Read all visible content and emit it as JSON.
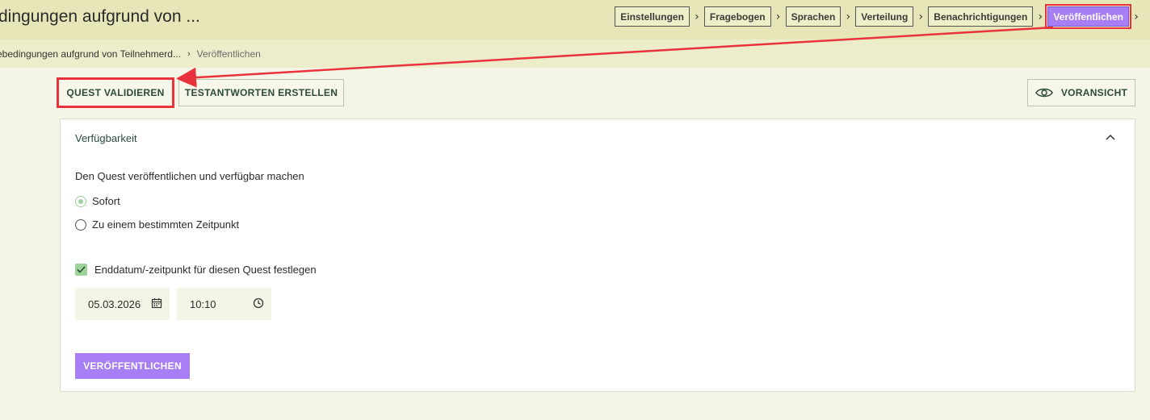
{
  "header": {
    "title": "dingungen aufgrund von ..."
  },
  "steps": [
    {
      "label": "Einstellungen"
    },
    {
      "label": "Fragebogen"
    },
    {
      "label": "Sprachen"
    },
    {
      "label": "Verteilung"
    },
    {
      "label": "Benachrichtigungen"
    },
    {
      "label": "Veröffentlichen",
      "active": true
    }
  ],
  "breadcrumb": {
    "parent": "ebedingungen aufgrund von Teilnehmerd...",
    "current": "Veröffentlichen"
  },
  "toolbar": {
    "validate_label": "QUEST VALIDIEREN",
    "test_label": "TESTANTWORTEN ERSTELLEN",
    "preview_label": "VORANSICHT"
  },
  "availability": {
    "title": "Verfügbarkeit",
    "description": "Den Quest veröffentlichen und verfügbar machen",
    "options": [
      {
        "label": "Sofort",
        "checked": true
      },
      {
        "label": "Zu einem bestimmten Zeitpunkt",
        "checked": false
      }
    ],
    "end_date_label": "Enddatum/-zeitpunkt für diesen Quest festlegen",
    "end_date_checked": true,
    "date_value": "05.03.2026",
    "time_value": "10:10",
    "publish_label": "VERÖFFENTLICHEN"
  },
  "colors": {
    "accent": "#a77ef4",
    "highlight": "#e8323c",
    "check": "#9bd39b"
  }
}
